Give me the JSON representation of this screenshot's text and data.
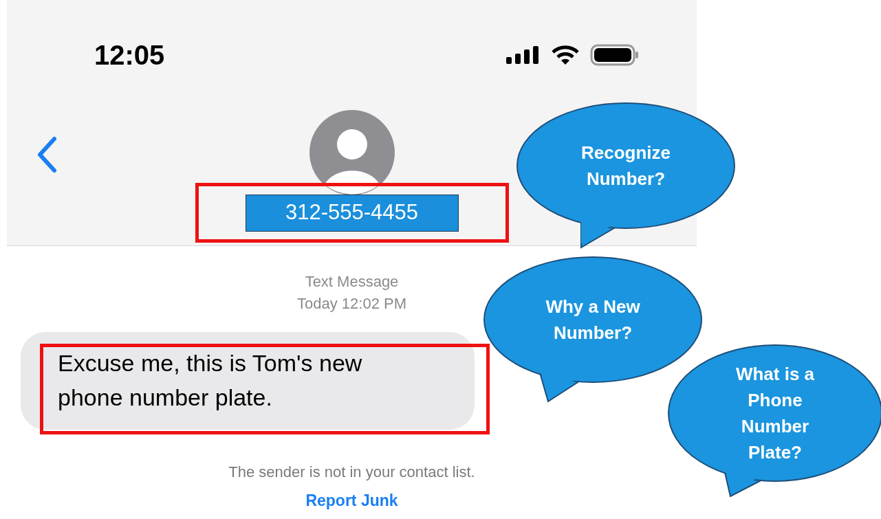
{
  "status_bar": {
    "time": "12:05"
  },
  "contact": {
    "number": "312-555-4455",
    "highlighted": true
  },
  "thread": {
    "label": "Text Message",
    "timestamp": "Today 12:02 PM"
  },
  "messages": [
    {
      "text": "Excuse me, this is Tom's new phone number plate.",
      "highlighted": true
    }
  ],
  "notice": "The sender is not in your contact list.",
  "report_link": "Report Junk",
  "callouts": [
    {
      "text": "Recognize\nNumber?"
    },
    {
      "text": "Why a New\nNumber?"
    },
    {
      "text": "What is a\nPhone\nNumber\nPlate?"
    }
  ]
}
